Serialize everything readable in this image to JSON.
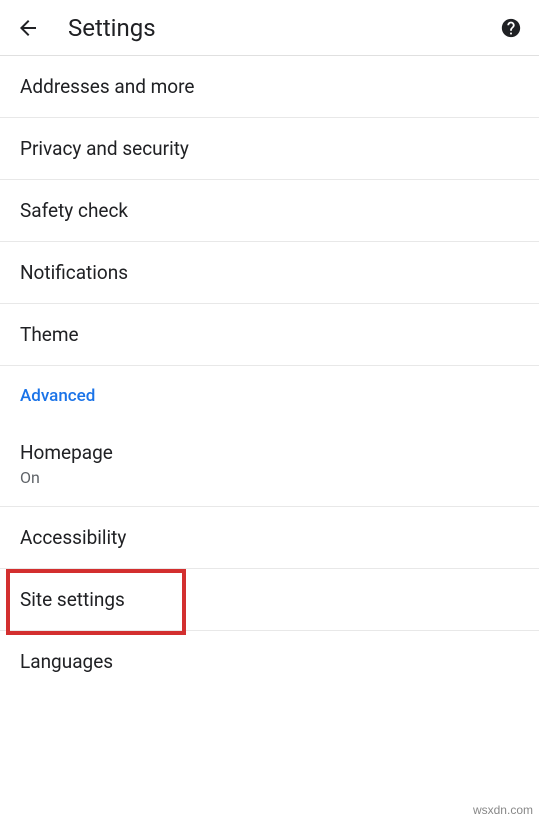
{
  "header": {
    "title": "Settings"
  },
  "items": [
    {
      "label": "Addresses and more"
    },
    {
      "label": "Privacy and security"
    },
    {
      "label": "Safety check"
    },
    {
      "label": "Notifications"
    },
    {
      "label": "Theme"
    }
  ],
  "section_header": "Advanced",
  "advanced_items": [
    {
      "label": "Homepage",
      "sub": "On"
    },
    {
      "label": "Accessibility"
    },
    {
      "label": "Site settings"
    },
    {
      "label": "Languages"
    }
  ],
  "watermark": "wsxdn.com"
}
